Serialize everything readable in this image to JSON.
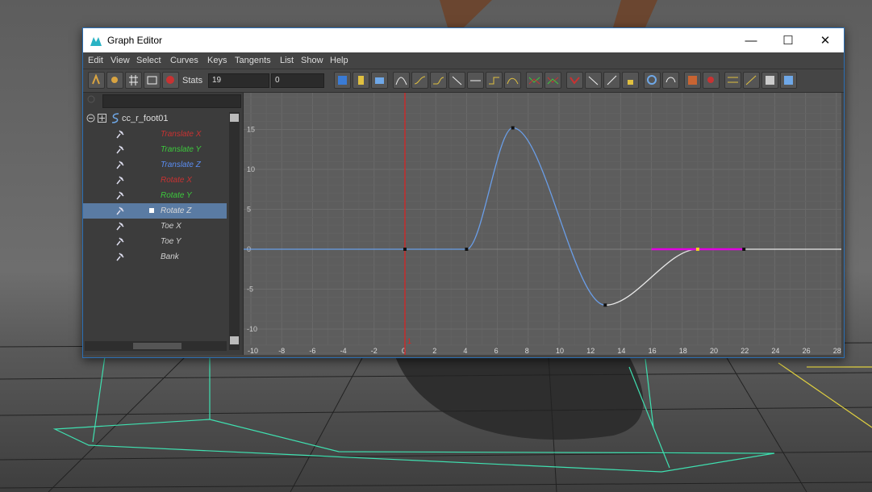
{
  "window": {
    "title": "Graph Editor",
    "minimize_glyph": "—",
    "maximize_glyph": "☐",
    "close_glyph": "✕"
  },
  "menu": [
    "Edit",
    "View",
    "Select",
    "Curves",
    "Keys",
    "Tangents",
    "List",
    "Show",
    "Help"
  ],
  "toolbar": {
    "stats_label": "Stats",
    "stats_value": "19",
    "value_field": "0"
  },
  "outliner": {
    "node": "cc_r_foot01",
    "attributes": [
      {
        "label": "Translate X",
        "color": "#c83232"
      },
      {
        "label": "Translate Y",
        "color": "#3cc83c"
      },
      {
        "label": "Translate Z",
        "color": "#5a8cf0"
      },
      {
        "label": "Rotate X",
        "color": "#c83232"
      },
      {
        "label": "Rotate Y",
        "color": "#3cc83c"
      },
      {
        "label": "Rotate Z",
        "color": "#d8d8d8",
        "selected": true
      },
      {
        "label": "Toe X",
        "color": "#cfcfcf"
      },
      {
        "label": "Toe Y",
        "color": "#cfcfcf"
      },
      {
        "label": "Bank",
        "color": "#cfcfcf"
      }
    ]
  },
  "graph": {
    "x_ticks": [
      -10,
      -8,
      -6,
      -4,
      -2,
      0,
      2,
      4,
      6,
      8,
      10,
      12,
      14,
      16,
      18,
      20,
      22,
      24,
      26,
      28
    ],
    "y_ticks": [
      15,
      10,
      5,
      0,
      -5,
      -10
    ],
    "current_frame": 0,
    "current_frame_label": "1",
    "curve_color": "#6a9ee8",
    "selected_segment_color": "#e000e0",
    "key_color": "#111111",
    "keys": [
      {
        "frame": 0,
        "value": 0
      },
      {
        "frame": 4,
        "value": 0
      },
      {
        "frame": 7,
        "value": 15.2
      },
      {
        "frame": 13,
        "value": -7
      },
      {
        "frame": 19,
        "value": 0,
        "selected": true
      },
      {
        "frame": 22,
        "value": 0
      }
    ]
  }
}
